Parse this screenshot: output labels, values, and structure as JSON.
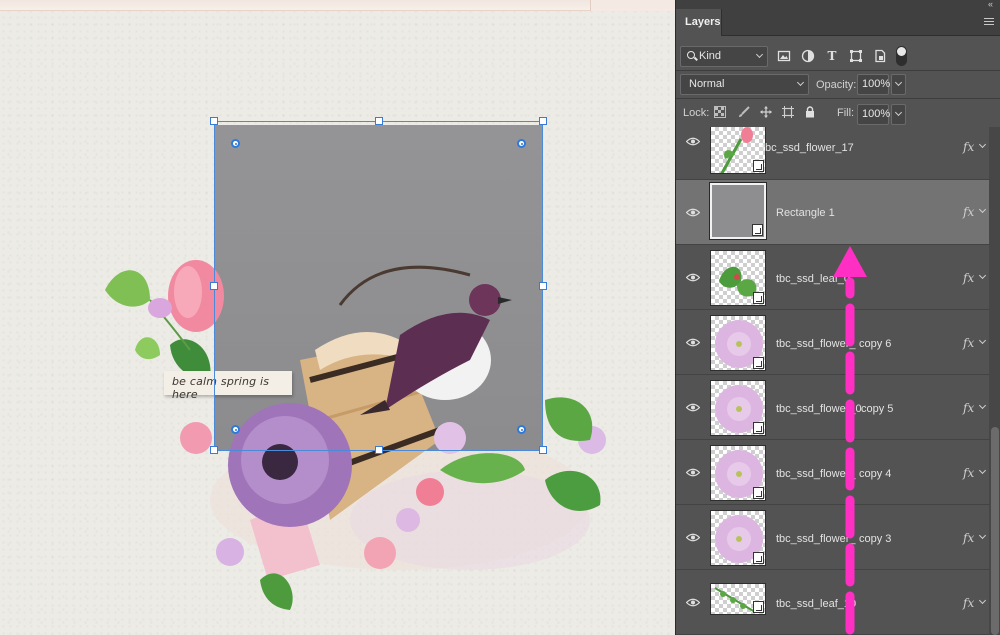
{
  "canvas": {
    "tag_text": "be calm spring is here"
  },
  "panel": {
    "tab_label": "Layers",
    "kind_label": "Kind",
    "blend_mode": "Normal",
    "opacity_label": "Opacity:",
    "opacity_value": "100%",
    "lock_label": "Lock:",
    "fill_label": "Fill:",
    "fill_value": "100%",
    "filter_icons": [
      "image-filter-icon",
      "adjustment-filter-icon",
      "type-filter-icon",
      "shape-filter-icon",
      "smart-object-filter-icon"
    ],
    "lock_icons": [
      "lock-transparent-pixels-icon",
      "lock-image-pixels-icon",
      "lock-position-icon",
      "lock-artboard-icon",
      "lock-all-icon"
    ]
  },
  "layers": [
    {
      "name": "tbc_ssd_flower_17",
      "fx": "fx",
      "selected": false,
      "thumb": "flower-bud"
    },
    {
      "name": "Rectangle 1",
      "fx": "fx",
      "selected": true,
      "thumb": "gray-shape"
    },
    {
      "name": "tbc_ssd_leaf_0",
      "fx": "fx",
      "selected": false,
      "thumb": "leaf"
    },
    {
      "name": "tbc_ssd_flower_",
      "suffix": "copy 6",
      "fx": "fx",
      "selected": false,
      "thumb": "flower"
    },
    {
      "name": "tbc_ssd_flower_0",
      "suffix": "copy 5",
      "fx": "fx",
      "selected": false,
      "thumb": "flower"
    },
    {
      "name": "tbc_ssd_flower_",
      "suffix": "copy 4",
      "fx": "fx",
      "selected": false,
      "thumb": "flower"
    },
    {
      "name": "tbc_ssd_flower_",
      "suffix": "copy 3",
      "fx": "fx",
      "selected": false,
      "thumb": "flower"
    },
    {
      "name": "tbc_ssd_leaf_10",
      "fx": "fx",
      "selected": false,
      "thumb": "leaf-sprig"
    }
  ],
  "colors": {
    "annotation_arrow": "#ff2fc4",
    "selection_blue": "#3a7bd5",
    "panel_bg": "#535353",
    "selected_row": "#737373"
  }
}
